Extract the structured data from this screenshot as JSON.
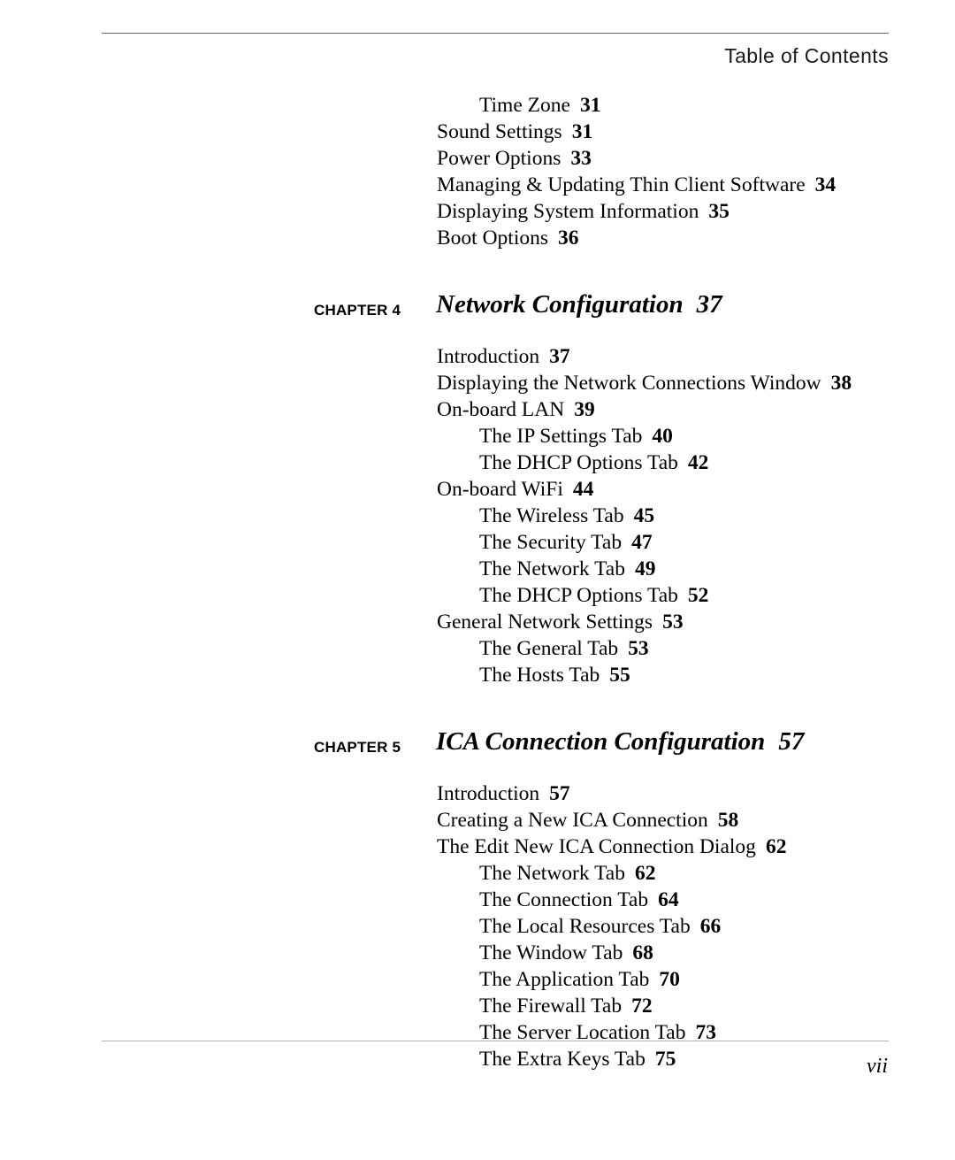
{
  "header": {
    "title": "Table of Contents"
  },
  "footer": {
    "page_number": "vii"
  },
  "toc": {
    "leading_entries": [
      {
        "title": "Time Zone",
        "page": "31",
        "level": 2
      },
      {
        "title": "Sound Settings",
        "page": "31",
        "level": 1
      },
      {
        "title": "Power Options",
        "page": "33",
        "level": 1
      },
      {
        "title": "Managing & Updating Thin Client Software",
        "page": "34",
        "level": 1
      },
      {
        "title": "Displaying System Information",
        "page": "35",
        "level": 1
      },
      {
        "title": "Boot Options",
        "page": "36",
        "level": 1
      }
    ],
    "chapters": [
      {
        "label": "CHAPTER 4",
        "title": "Network Configuration",
        "page": "37",
        "entries": [
          {
            "title": "Introduction",
            "page": "37",
            "level": 1
          },
          {
            "title": "Displaying the Network Connections Window",
            "page": "38",
            "level": 1
          },
          {
            "title": "On-board LAN",
            "page": "39",
            "level": 1
          },
          {
            "title": "The IP Settings Tab",
            "page": "40",
            "level": 2
          },
          {
            "title": "The DHCP Options Tab",
            "page": "42",
            "level": 2
          },
          {
            "title": "On-board WiFi",
            "page": "44",
            "level": 1
          },
          {
            "title": "The Wireless Tab",
            "page": "45",
            "level": 2
          },
          {
            "title": "The Security Tab",
            "page": "47",
            "level": 2
          },
          {
            "title": "The Network Tab",
            "page": "49",
            "level": 2
          },
          {
            "title": "The DHCP Options Tab",
            "page": "52",
            "level": 2
          },
          {
            "title": "General Network Settings",
            "page": "53",
            "level": 1
          },
          {
            "title": "The General Tab",
            "page": "53",
            "level": 2
          },
          {
            "title": "The Hosts Tab",
            "page": "55",
            "level": 2
          }
        ]
      },
      {
        "label": "CHAPTER 5",
        "title": "ICA Connection Configuration",
        "page": "57",
        "entries": [
          {
            "title": "Introduction",
            "page": "57",
            "level": 1
          },
          {
            "title": "Creating a New ICA Connection",
            "page": "58",
            "level": 1
          },
          {
            "title": "The Edit New ICA Connection Dialog",
            "page": "62",
            "level": 1
          },
          {
            "title": "The Network Tab",
            "page": "62",
            "level": 2
          },
          {
            "title": "The Connection Tab",
            "page": "64",
            "level": 2
          },
          {
            "title": "The Local Resources Tab",
            "page": "66",
            "level": 2
          },
          {
            "title": "The Window Tab",
            "page": "68",
            "level": 2
          },
          {
            "title": "The Application Tab",
            "page": "70",
            "level": 2
          },
          {
            "title": "The Firewall Tab",
            "page": "72",
            "level": 2
          },
          {
            "title": "The Server Location Tab",
            "page": "73",
            "level": 2
          },
          {
            "title": "The Extra Keys Tab",
            "page": "75",
            "level": 2
          }
        ]
      }
    ]
  }
}
